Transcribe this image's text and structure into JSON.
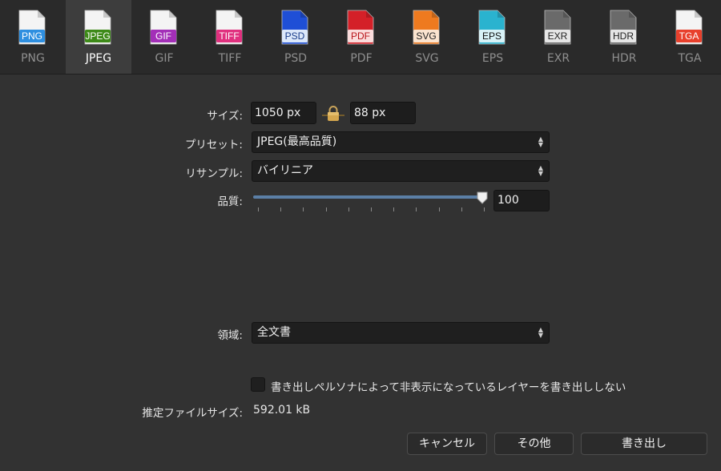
{
  "formats": [
    {
      "name": "PNG",
      "badge": "PNG",
      "color": "#2e8fe0"
    },
    {
      "name": "JPEG",
      "badge": "JPEG",
      "color": "#3d8a18",
      "selected": true
    },
    {
      "name": "GIF",
      "badge": "GIF",
      "color": "#a32fb8"
    },
    {
      "name": "TIFF",
      "badge": "TIFF",
      "color": "#e0307e"
    },
    {
      "name": "PSD",
      "badge": "PSD",
      "color": "#dce8fa",
      "text_color": "#1a3d8a",
      "page": "#1f4fd6"
    },
    {
      "name": "PDF",
      "badge": "PDF",
      "color": "#fadcdc",
      "text_color": "#b8141a",
      "page": "#d42028"
    },
    {
      "name": "SVG",
      "badge": "SVG",
      "color": "#fbe4d0",
      "text_color": "#222222",
      "page": "#ee7a1f"
    },
    {
      "name": "EPS",
      "badge": "EPS",
      "color": "#d8f2f7",
      "text_color": "#111111",
      "page": "#2ab3cf"
    },
    {
      "name": "EXR",
      "badge": "EXR",
      "color": "#e6e6e6",
      "text_color": "#222222",
      "page": "#6a6a6a"
    },
    {
      "name": "HDR",
      "badge": "HDR",
      "color": "#e6e6e6",
      "text_color": "#222222",
      "page": "#6a6a6a"
    },
    {
      "name": "TGA",
      "badge": "TGA",
      "color": "#e8402c"
    }
  ],
  "size": {
    "label": "サイズ:",
    "width": "1050 px",
    "height": "88 px"
  },
  "preset": {
    "label": "プリセット:",
    "value": "JPEG(最高品質)"
  },
  "resample": {
    "label": "リサンプル:",
    "value": "バイリニア"
  },
  "quality": {
    "label": "品質:",
    "value": "100",
    "level_percent": 100
  },
  "area": {
    "label": "領域:",
    "value": "全文書"
  },
  "hidden_layers": {
    "label": "書き出しペルソナによって非表示になっているレイヤーを書き出ししない",
    "checked": false
  },
  "estimate": {
    "label": "推定ファイルサイズ:",
    "value": "592.01 kB"
  },
  "buttons": {
    "cancel": "キャンセル",
    "more": "その他",
    "export": "書き出し"
  },
  "colors": {
    "accent": "#5b7fa6",
    "background": "#323232"
  }
}
